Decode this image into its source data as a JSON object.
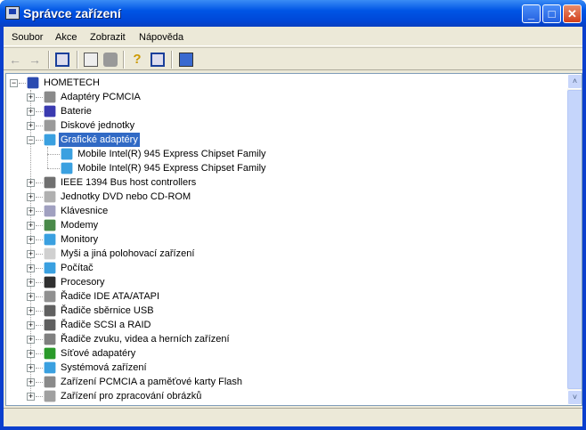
{
  "window": {
    "title": "Správce zařízení",
    "minimize": "_",
    "maximize": "□",
    "close": "✕"
  },
  "menu": [
    "Soubor",
    "Akce",
    "Zobrazit",
    "Nápověda"
  ],
  "toolbar": [
    "back-icon",
    "forward-icon",
    "show-hide-tree-icon",
    "properties-icon",
    "print-icon",
    "help-icon",
    "show-hide-action-pane-icon",
    "scan-hardware-icon"
  ],
  "tree": {
    "root": "HOMETECH",
    "items": [
      {
        "label": "Adaptéry PCMCIA",
        "color": "#8a8a8a"
      },
      {
        "label": "Baterie",
        "color": "#3a3ab0"
      },
      {
        "label": "Diskové jednotky",
        "color": "#9a9a9a"
      },
      {
        "label": "Grafické adaptéry",
        "color": "#3aa0e0",
        "expanded": true,
        "selected": true,
        "children": [
          "Mobile Intel(R) 945 Express Chipset Family",
          "Mobile Intel(R) 945 Express Chipset Family"
        ]
      },
      {
        "label": "IEEE 1394 Bus host controllers",
        "color": "#707070"
      },
      {
        "label": "Jednotky DVD nebo CD-ROM",
        "color": "#b0b0b0"
      },
      {
        "label": "Klávesnice",
        "color": "#a0a0c0"
      },
      {
        "label": "Modemy",
        "color": "#4a8a4a"
      },
      {
        "label": "Monitory",
        "color": "#3aa0e0"
      },
      {
        "label": "Myši a jiná polohovací zařízení",
        "color": "#d0d0d0"
      },
      {
        "label": "Počítač",
        "color": "#3aa0e0"
      },
      {
        "label": "Procesory",
        "color": "#303030"
      },
      {
        "label": "Řadiče IDE ATA/ATAPI",
        "color": "#909090"
      },
      {
        "label": "Řadiče sběrnice USB",
        "color": "#606060"
      },
      {
        "label": "Řadiče SCSI a RAID",
        "color": "#606060"
      },
      {
        "label": "Řadiče zvuku, videa a herních zařízení",
        "color": "#808080"
      },
      {
        "label": "Síťové adapatéry",
        "color": "#2a9a2a"
      },
      {
        "label": "Systémová zařízení",
        "color": "#3aa0e0"
      },
      {
        "label": "Zařízení PCMCIA a paměťové karty Flash",
        "color": "#8a8a8a"
      },
      {
        "label": "Zařízení pro zpracování obrázků",
        "color": "#a0a0a0"
      }
    ]
  },
  "scrollbar": {
    "up": "˄",
    "down": "˅"
  }
}
